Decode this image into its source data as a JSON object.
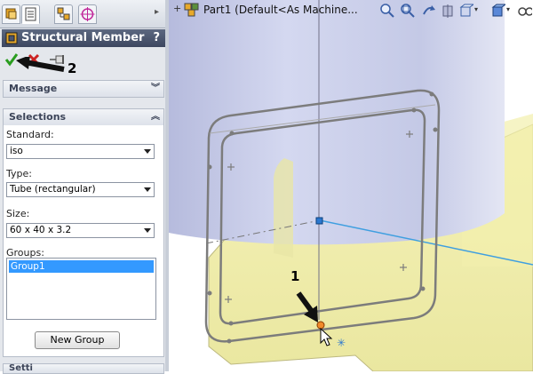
{
  "panel": {
    "title": "Structural Member",
    "help_label": "?",
    "callout_2": "2",
    "message_section": {
      "title": "Message"
    },
    "selections_section": {
      "title": "Selections",
      "standard": {
        "label": "Standard:",
        "value": "iso"
      },
      "type": {
        "label": "Type:",
        "value": "Tube (rectangular)"
      },
      "size": {
        "label": "Size:",
        "value": "60 x 40 x 3.2"
      },
      "groups": {
        "label": "Groups:",
        "items": [
          "Group1"
        ]
      },
      "new_group_label": "New Group"
    },
    "bottom_section_title": "Setti"
  },
  "viewport": {
    "document_title": "Part1  (Default<As Machine...",
    "callout_1": "1"
  },
  "colors": {
    "title_bar": "#4b5671",
    "selection_blue": "#3399ff",
    "solid_blue": "#c6cbe6",
    "solid_yellow": "#f6f3b4",
    "sketch_gray": "#7c7c7c",
    "confirm_green": "#2a9d1f",
    "cancel_red": "#cc2222"
  },
  "icons": [
    "feature-manager-icon",
    "property-manager-icon",
    "configuration-manager-icon",
    "dimxpert-icon",
    "structural-member-icon",
    "ok-check-icon",
    "cancel-x-icon",
    "pushpin-icon",
    "zoom-to-fit-icon",
    "zoom-area-icon",
    "previous-view-icon",
    "section-view-icon",
    "view-orientation-icon",
    "display-style-icon",
    "hide-show-icon"
  ]
}
